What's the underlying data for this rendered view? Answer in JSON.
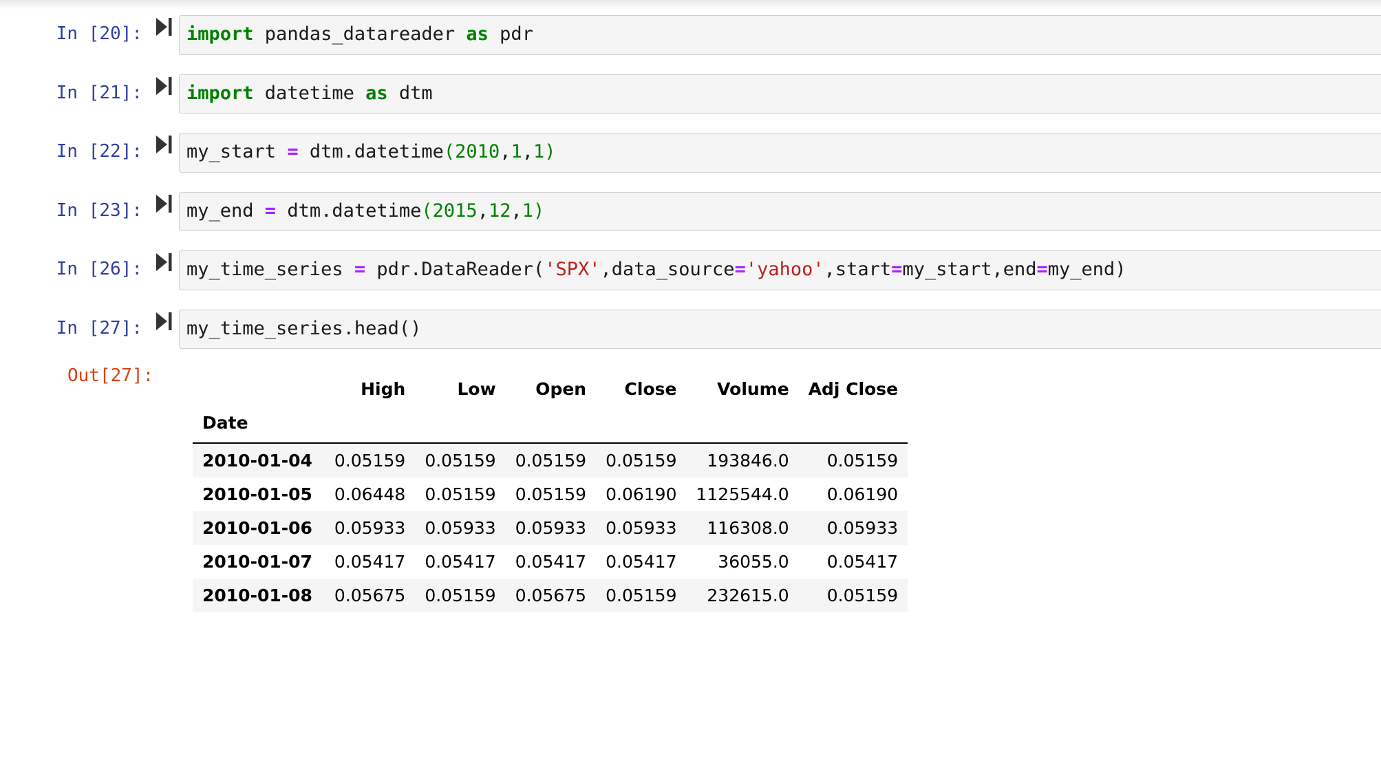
{
  "notebook": {
    "cells": [
      {
        "prompt": "In [20]:",
        "run_icon": "run-cell-icon",
        "code_tokens": [
          {
            "t": "import",
            "c": "kw"
          },
          {
            "t": " pandas_datareader ",
            "c": "plain"
          },
          {
            "t": "as",
            "c": "kw"
          },
          {
            "t": " pdr",
            "c": "plain"
          }
        ]
      },
      {
        "prompt": "In [21]:",
        "run_icon": "run-cell-icon",
        "code_tokens": [
          {
            "t": "import",
            "c": "kw"
          },
          {
            "t": " datetime ",
            "c": "plain"
          },
          {
            "t": "as",
            "c": "kw"
          },
          {
            "t": " dtm",
            "c": "plain"
          }
        ]
      },
      {
        "prompt": "In [22]:",
        "run_icon": "run-cell-icon",
        "code_tokens": [
          {
            "t": "my_start ",
            "c": "plain"
          },
          {
            "t": "=",
            "c": "op"
          },
          {
            "t": " dtm.datetime",
            "c": "plain"
          },
          {
            "t": "(",
            "c": "punc"
          },
          {
            "t": "2010",
            "c": "num"
          },
          {
            "t": ",",
            "c": "plain"
          },
          {
            "t": "1",
            "c": "num"
          },
          {
            "t": ",",
            "c": "plain"
          },
          {
            "t": "1",
            "c": "num"
          },
          {
            "t": ")",
            "c": "punc"
          }
        ]
      },
      {
        "prompt": "In [23]:",
        "run_icon": "run-cell-icon",
        "code_tokens": [
          {
            "t": "my_end ",
            "c": "plain"
          },
          {
            "t": "=",
            "c": "op"
          },
          {
            "t": " dtm.datetime",
            "c": "plain"
          },
          {
            "t": "(",
            "c": "punc"
          },
          {
            "t": "2015",
            "c": "num"
          },
          {
            "t": ",",
            "c": "plain"
          },
          {
            "t": "12",
            "c": "num"
          },
          {
            "t": ",",
            "c": "plain"
          },
          {
            "t": "1",
            "c": "num"
          },
          {
            "t": ")",
            "c": "punc"
          }
        ]
      },
      {
        "prompt": "In [26]:",
        "run_icon": "run-cell-icon",
        "code_tokens": [
          {
            "t": "my_time_series ",
            "c": "plain"
          },
          {
            "t": "=",
            "c": "op"
          },
          {
            "t": " pdr.DataReader(",
            "c": "plain"
          },
          {
            "t": "'SPX'",
            "c": "str"
          },
          {
            "t": ",data_source",
            "c": "plain"
          },
          {
            "t": "=",
            "c": "op"
          },
          {
            "t": "'yahoo'",
            "c": "str"
          },
          {
            "t": ",start",
            "c": "plain"
          },
          {
            "t": "=",
            "c": "op"
          },
          {
            "t": "my_start,end",
            "c": "plain"
          },
          {
            "t": "=",
            "c": "op"
          },
          {
            "t": "my_end)",
            "c": "plain"
          }
        ]
      },
      {
        "prompt": "In [27]:",
        "run_icon": "run-cell-icon",
        "code_tokens": [
          {
            "t": "my_time_series.head()",
            "c": "plain"
          }
        ]
      }
    ],
    "output": {
      "prompt": "Out[27]:",
      "dataframe": {
        "index_name": "Date",
        "columns": [
          "High",
          "Low",
          "Open",
          "Close",
          "Volume",
          "Adj Close"
        ],
        "index": [
          "2010-01-04",
          "2010-01-05",
          "2010-01-06",
          "2010-01-07",
          "2010-01-08"
        ],
        "rows": [
          [
            "0.05159",
            "0.05159",
            "0.05159",
            "0.05159",
            "193846.0",
            "0.05159"
          ],
          [
            "0.06448",
            "0.05159",
            "0.05159",
            "0.06190",
            "1125544.0",
            "0.06190"
          ],
          [
            "0.05933",
            "0.05933",
            "0.05933",
            "0.05933",
            "116308.0",
            "0.05933"
          ],
          [
            "0.05417",
            "0.05417",
            "0.05417",
            "0.05417",
            "36055.0",
            "0.05417"
          ],
          [
            "0.05675",
            "0.05159",
            "0.05675",
            "0.05159",
            "232615.0",
            "0.05159"
          ]
        ]
      }
    }
  },
  "colors": {
    "in_prompt": "#303F9F",
    "out_prompt": "#D84315",
    "keyword": "#008000",
    "number": "#008000",
    "operator": "#AA22FF",
    "string": "#BA2121",
    "cell_bg": "#f5f5f5",
    "cell_border": "#cfcfcf"
  }
}
